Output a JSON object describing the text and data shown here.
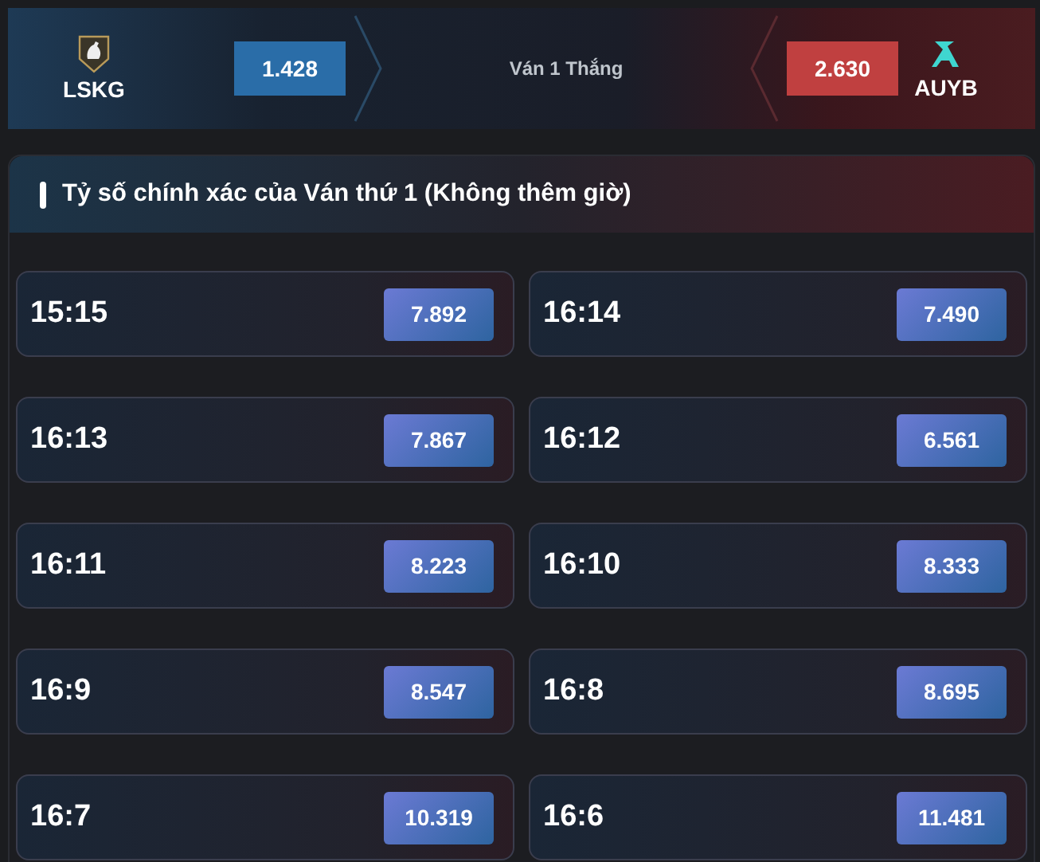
{
  "match": {
    "home": {
      "name": "LSKG",
      "odds": "1.428"
    },
    "market": "Ván 1 Thắng",
    "away": {
      "name": "AUYB",
      "odds": "2.630"
    }
  },
  "panel": {
    "title": "Tỷ số chính xác của Ván thứ 1 (Không thêm giờ)",
    "options": [
      {
        "score": "15:15",
        "odds": "7.892"
      },
      {
        "score": "16:14",
        "odds": "7.490"
      },
      {
        "score": "16:13",
        "odds": "7.867"
      },
      {
        "score": "16:12",
        "odds": "6.561"
      },
      {
        "score": "16:11",
        "odds": "8.223"
      },
      {
        "score": "16:10",
        "odds": "8.333"
      },
      {
        "score": "16:9",
        "odds": "8.547"
      },
      {
        "score": "16:8",
        "odds": "8.695"
      },
      {
        "score": "16:7",
        "odds": "10.319"
      },
      {
        "score": "16:6",
        "odds": "11.481"
      }
    ]
  }
}
